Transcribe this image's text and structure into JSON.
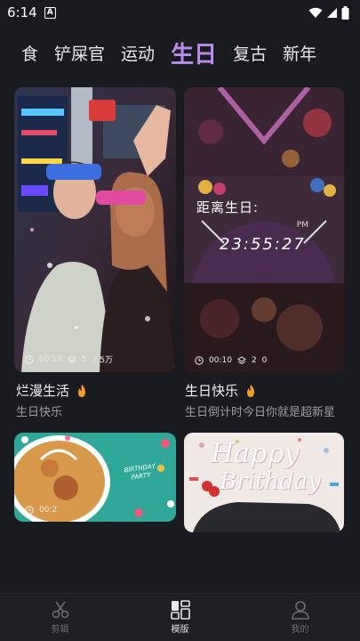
{
  "status": {
    "time": "6:14",
    "notification_glyph": "A"
  },
  "tabs": [
    {
      "label": "食"
    },
    {
      "label": "铲屎官"
    },
    {
      "label": "运动"
    },
    {
      "label": "生日",
      "active": true
    },
    {
      "label": "复古"
    },
    {
      "label": "新年"
    }
  ],
  "cards": [
    {
      "title": "烂漫生活",
      "subtitle": "生日快乐",
      "duration": "00:19",
      "layers": "5",
      "views": "7.5万"
    },
    {
      "title": "生日快乐",
      "subtitle": "生日倒计时今日你就是超新星",
      "duration": "00:10",
      "layers": "2",
      "views": "0",
      "countdown_label": "距离生日:",
      "countdown_ampm": "PM",
      "countdown_time": "23:55:27"
    },
    {
      "duration": "00:2",
      "image_text": "BIRTHDAY PARTY"
    },
    {
      "image_text_line1": "Happy",
      "image_text_line2": "Brithday"
    }
  ],
  "bottom_nav": [
    {
      "label": "剪辑",
      "icon": "scissors-icon"
    },
    {
      "label": "模版",
      "icon": "template-icon",
      "active": true
    },
    {
      "label": "我的",
      "icon": "profile-icon"
    }
  ]
}
